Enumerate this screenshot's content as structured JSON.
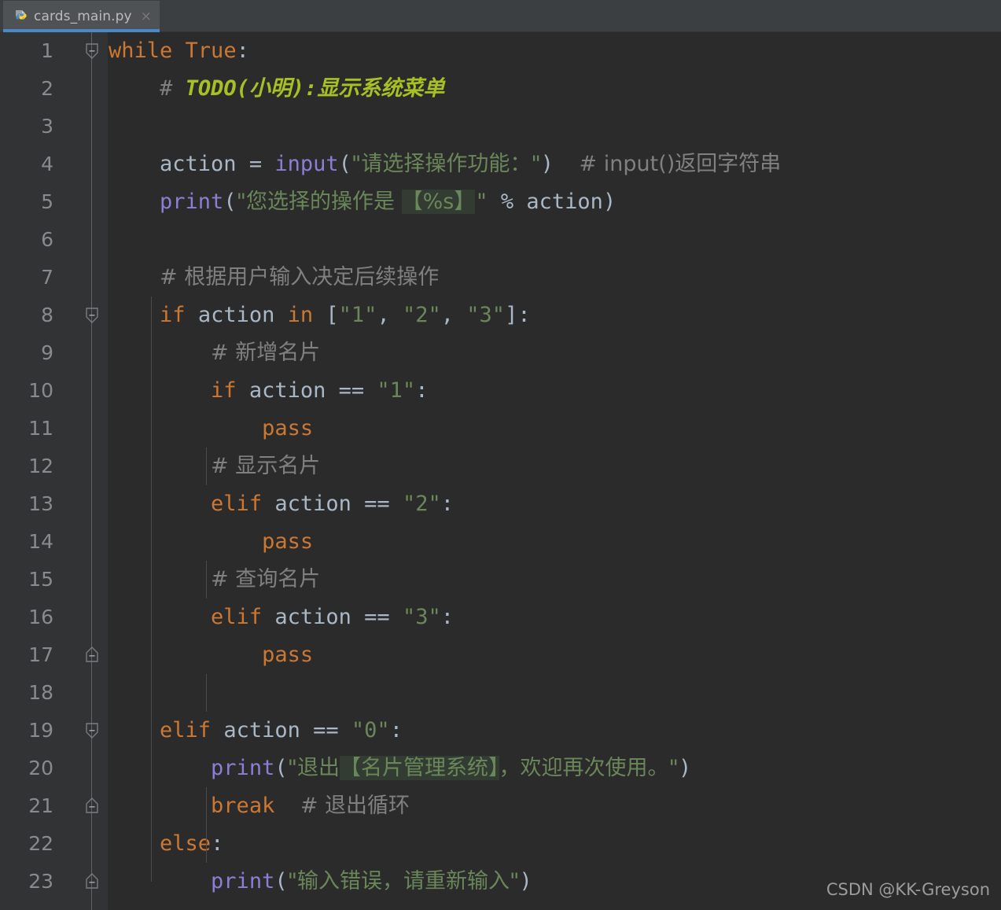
{
  "tab": {
    "label": "cards_main.py",
    "close_label": "×",
    "icon": "python-file-icon",
    "accent_color": "#4a88c7"
  },
  "editor": {
    "theme": "darcula",
    "background": "#2b2b2b",
    "gutter_background": "#313335",
    "first_visible_line": 1,
    "last_visible_line": 23,
    "colors": {
      "keyword": "#cc7832",
      "string": "#6a8759",
      "comment": "#808080",
      "todo": "#a8c023",
      "builtin_function": "#8a7fd4",
      "identifier": "#a9b7c6",
      "line_number": "#888b8d",
      "indent_guide": "#4b4b4b",
      "placeholder_highlight": "#323c32"
    },
    "line_numbers": [
      1,
      2,
      3,
      4,
      5,
      6,
      7,
      8,
      9,
      10,
      11,
      12,
      13,
      14,
      15,
      16,
      17,
      18,
      19,
      20,
      21,
      22,
      23
    ],
    "fold_markers": [
      {
        "line": 1,
        "type": "collapse-start"
      },
      {
        "line": 8,
        "type": "collapse-start"
      },
      {
        "line": 17,
        "type": "collapse-end"
      },
      {
        "line": 19,
        "type": "collapse-start"
      },
      {
        "line": 21,
        "type": "collapse-end"
      },
      {
        "line": 23,
        "type": "collapse-end"
      }
    ],
    "lines": [
      {
        "n": 1,
        "text": "while True:"
      },
      {
        "n": 2,
        "text": "    # TODO(小明):显示系统菜单"
      },
      {
        "n": 3,
        "text": ""
      },
      {
        "n": 4,
        "text": "    action = input(\"请选择操作功能：\")  # input()返回字符串"
      },
      {
        "n": 5,
        "text": "    print(\"您选择的操作是 【%s】\" % action)"
      },
      {
        "n": 6,
        "text": ""
      },
      {
        "n": 7,
        "text": "    # 根据用户输入决定后续操作"
      },
      {
        "n": 8,
        "text": "    if action in [\"1\", \"2\", \"3\"]:"
      },
      {
        "n": 9,
        "text": "        # 新增名片"
      },
      {
        "n": 10,
        "text": "        if action == \"1\":"
      },
      {
        "n": 11,
        "text": "            pass"
      },
      {
        "n": 12,
        "text": "        # 显示名片"
      },
      {
        "n": 13,
        "text": "        elif action == \"2\":"
      },
      {
        "n": 14,
        "text": "            pass"
      },
      {
        "n": 15,
        "text": "        # 查询名片"
      },
      {
        "n": 16,
        "text": "        elif action == \"3\":"
      },
      {
        "n": 17,
        "text": "            pass"
      },
      {
        "n": 18,
        "text": ""
      },
      {
        "n": 19,
        "text": "    elif action == \"0\":"
      },
      {
        "n": 20,
        "text": "        print(\"退出【名片管理系统】，欢迎再次使用。\")"
      },
      {
        "n": 21,
        "text": "        break  # 退出循环"
      },
      {
        "n": 22,
        "text": "    else:"
      },
      {
        "n": 23,
        "text": "        print(\"输入错误，请重新输入\")"
      }
    ],
    "tokens": {
      "l1": {
        "kw": "while",
        "bool": "True",
        "colon": ":"
      },
      "l2": {
        "hash": "#",
        "todo": "TODO(小明):显示系统菜单"
      },
      "l4": {
        "var": "action",
        "eq": "=",
        "fn": "input",
        "str": "\"请选择操作功能：\"",
        "cmt": "# input()返回字符串"
      },
      "l5": {
        "fn": "print",
        "str_a": "\"您选择的操作是 ",
        "hl": "【%s】",
        "str_b": "\"",
        "op": "%",
        "var": "action"
      },
      "l7": {
        "cmt": "# 根据用户输入决定后续操作"
      },
      "l8": {
        "kw_if": "if",
        "var": "action",
        "kw_in": "in",
        "s1": "\"1\"",
        "s2": "\"2\"",
        "s3": "\"3\""
      },
      "l9": {
        "cmt": "# 新增名片"
      },
      "l10": {
        "kw": "if",
        "var": "action",
        "op": "==",
        "str": "\"1\""
      },
      "l11": {
        "kw": "pass"
      },
      "l12": {
        "cmt": "# 显示名片"
      },
      "l13": {
        "kw": "elif",
        "var": "action",
        "op": "==",
        "str": "\"2\""
      },
      "l14": {
        "kw": "pass"
      },
      "l15": {
        "cmt": "# 查询名片"
      },
      "l16": {
        "kw": "elif",
        "var": "action",
        "op": "==",
        "str": "\"3\""
      },
      "l17": {
        "kw": "pass"
      },
      "l19": {
        "kw": "elif",
        "var": "action",
        "op": "==",
        "str": "\"0\""
      },
      "l20": {
        "fn": "print",
        "str_a": "\"退出",
        "hl": "【名片管理系统】",
        "str_b": "，欢迎再次使用。\""
      },
      "l21": {
        "kw": "break",
        "cmt": "# 退出循环"
      },
      "l22": {
        "kw": "else",
        "colon": ":"
      },
      "l23": {
        "fn": "print",
        "str": "\"输入错误，请重新输入\""
      }
    }
  },
  "watermark": {
    "text": "CSDN @KK-Greyson"
  }
}
